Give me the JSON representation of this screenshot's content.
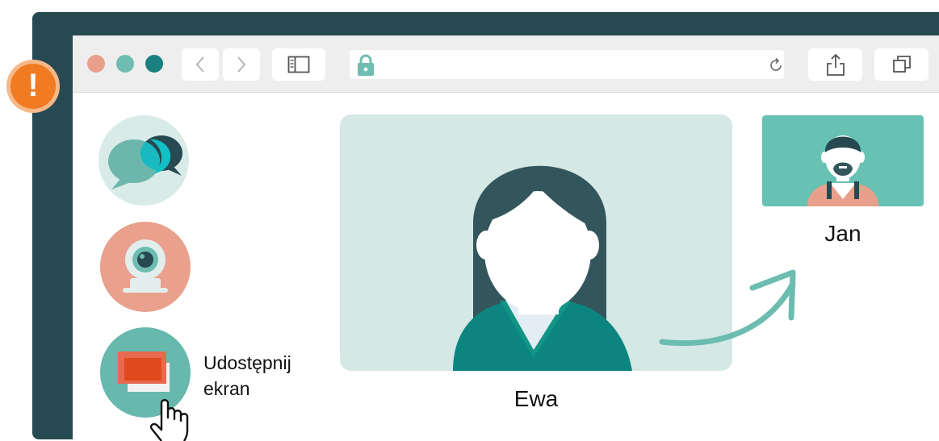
{
  "colors": {
    "frame": "#274a52",
    "toolbar": "#eeeeee",
    "dot_close": "#e8a08c",
    "dot_minimize": "#6fbdb0",
    "dot_zoom": "#1b8080",
    "lock": "#6fbdb0",
    "warning": "#f07b22",
    "main_video_bg": "#d4e8e5",
    "thumb_video_bg": "#67c2b4",
    "arrow": "#6cbcb0",
    "hair": "#33565d",
    "sweater": "#0c8580",
    "shirt": "#e8a08c"
  },
  "browser": {
    "icons": {
      "back": "chevron-left-icon",
      "forward": "chevron-right-icon",
      "sidebar": "sidebar-icon",
      "lock": "lock-icon",
      "reload": "reload-icon",
      "share": "share-icon",
      "tabs": "tabs-icon"
    }
  },
  "alert": {
    "icon": "warning-icon",
    "glyph": "!"
  },
  "sidebar": {
    "items": [
      {
        "icon": "chat-icon"
      },
      {
        "icon": "webcam-icon"
      },
      {
        "icon": "screen-share-icon",
        "label_line1": "Udostępnij",
        "label_line2": "ekran"
      }
    ]
  },
  "main_video": {
    "participant": "Ewa"
  },
  "thumbnail_video": {
    "participant": "Jan"
  }
}
